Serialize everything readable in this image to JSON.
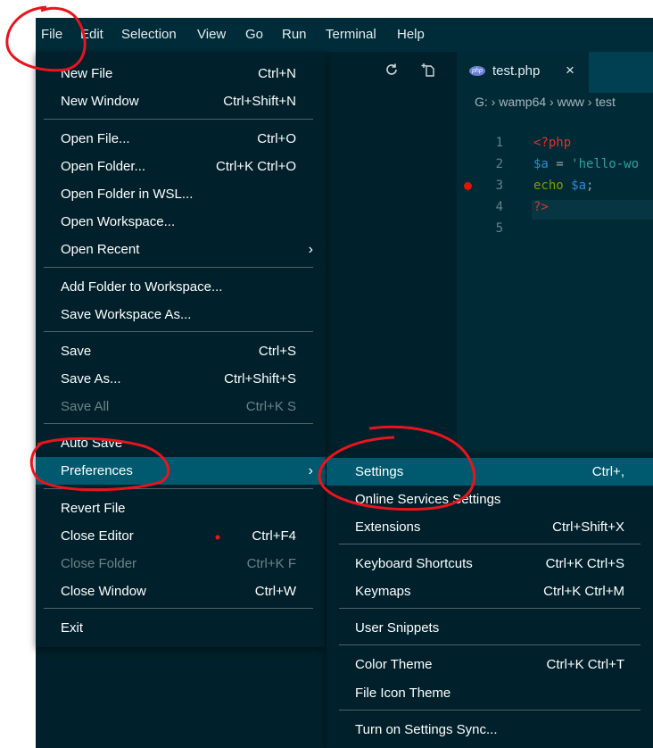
{
  "menubar": {
    "items": [
      "File",
      "Edit",
      "Selection",
      "View",
      "Go",
      "Run",
      "Terminal",
      "Help"
    ]
  },
  "explorer_toolbar": {
    "icons": [
      "refresh-icon",
      "new-file-icon"
    ]
  },
  "editor": {
    "tab": {
      "label": "test.php",
      "close": "×",
      "icon": "php-file-icon"
    },
    "breadcrumb": "G: › wamp64 › www › test",
    "lines": [
      {
        "num": "1",
        "text": "<?php"
      },
      {
        "num": "2",
        "text": "$a = 'hello-wo"
      },
      {
        "num": "3",
        "text": "echo $a;"
      },
      {
        "num": "4",
        "text": "?>"
      },
      {
        "num": "5",
        "text": ""
      }
    ],
    "breakpoint_line": 3
  },
  "file_menu": {
    "items": [
      {
        "label": "New File",
        "shortcut": "Ctrl+N"
      },
      {
        "label": "New Window",
        "shortcut": "Ctrl+Shift+N"
      },
      {
        "label": "Open File...",
        "shortcut": "Ctrl+O"
      },
      {
        "label": "Open Folder...",
        "shortcut": "Ctrl+K Ctrl+O"
      },
      {
        "label": "Open Folder in WSL...",
        "shortcut": ""
      },
      {
        "label": "Open Workspace...",
        "shortcut": ""
      },
      {
        "label": "Open Recent",
        "shortcut": ""
      },
      {
        "label": "Add Folder to Workspace...",
        "shortcut": ""
      },
      {
        "label": "Save Workspace As...",
        "shortcut": ""
      },
      {
        "label": "Save",
        "shortcut": "Ctrl+S"
      },
      {
        "label": "Save As...",
        "shortcut": "Ctrl+Shift+S"
      },
      {
        "label": "Save All",
        "shortcut": "Ctrl+K S"
      },
      {
        "label": "Auto Save",
        "shortcut": ""
      },
      {
        "label": "Preferences",
        "shortcut": ""
      },
      {
        "label": "Revert File",
        "shortcut": ""
      },
      {
        "label": "Close Editor",
        "shortcut": "Ctrl+F4"
      },
      {
        "label": "Close Folder",
        "shortcut": "Ctrl+K F"
      },
      {
        "label": "Close Window",
        "shortcut": "Ctrl+W"
      },
      {
        "label": "Exit",
        "shortcut": ""
      }
    ]
  },
  "preferences_menu": {
    "items": [
      {
        "label": "Settings",
        "shortcut": "Ctrl+,"
      },
      {
        "label": "Online Services Settings",
        "shortcut": ""
      },
      {
        "label": "Extensions",
        "shortcut": "Ctrl+Shift+X"
      },
      {
        "label": "Keyboard Shortcuts",
        "shortcut": "Ctrl+K Ctrl+S"
      },
      {
        "label": "Keymaps",
        "shortcut": "Ctrl+K Ctrl+M"
      },
      {
        "label": "User Snippets",
        "shortcut": ""
      },
      {
        "label": "Color Theme",
        "shortcut": "Ctrl+K Ctrl+T"
      },
      {
        "label": "File Icon Theme",
        "shortcut": ""
      },
      {
        "label": "Turn on Settings Sync...",
        "shortcut": ""
      }
    ]
  },
  "colors": {
    "window_bg": "#002b36",
    "menu_bg": "#00212b",
    "menu_active": "#005a6f",
    "annotation_red": "#e8141e",
    "php_tag": "#dc322f",
    "variable": "#268bd2",
    "string": "#2aa198",
    "keyword": "#859900"
  }
}
